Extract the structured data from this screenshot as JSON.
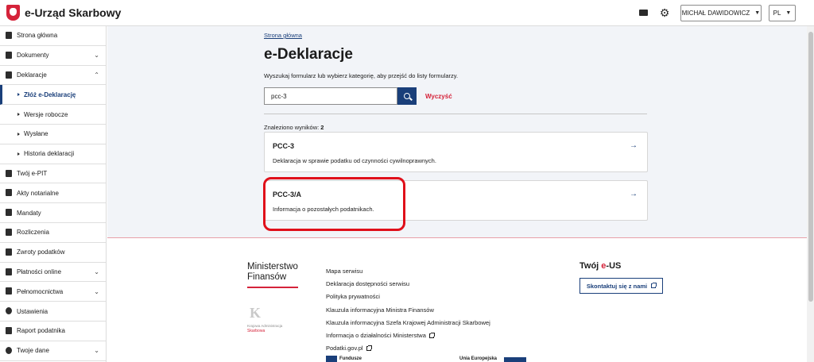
{
  "header": {
    "logo_text": "e-Urząd Skarbowy",
    "user_name": "MICHAŁ DAWIDOWICZ",
    "language": "PL",
    "mail_icon": "mail-icon",
    "settings_icon": "gear-icon"
  },
  "sidebar": {
    "items": [
      {
        "label": "Strona główna",
        "icon": "home-icon"
      },
      {
        "label": "Dokumenty",
        "icon": "document-icon"
      },
      {
        "label": "Deklaracje",
        "icon": "declaration-icon"
      },
      {
        "label": "Złóż e-Deklarację"
      },
      {
        "label": "Wersje robocze"
      },
      {
        "label": "Wysłane"
      },
      {
        "label": "Historia deklaracji"
      },
      {
        "label": "Twój e-PIT",
        "icon": "pit-icon"
      },
      {
        "label": "Akty notarialne",
        "icon": "notary-icon"
      },
      {
        "label": "Mandaty",
        "icon": "gavel-icon"
      },
      {
        "label": "Rozliczenia",
        "icon": "wallet-icon"
      },
      {
        "label": "Zwroty podatków",
        "icon": "refund-icon"
      },
      {
        "label": "Płatności online",
        "icon": "payment-icon"
      },
      {
        "label": "Pełnomocnictwa",
        "icon": "proxy-icon"
      },
      {
        "label": "Ustawienia",
        "icon": "gear-icon"
      },
      {
        "label": "Raport podatnika",
        "icon": "report-icon"
      },
      {
        "label": "Twoje dane",
        "icon": "user-icon"
      }
    ]
  },
  "main": {
    "breadcrumb": "Strona główna",
    "title": "e-Deklaracje",
    "intro": "Wyszukaj formularz lub wybierz kategorię, aby przejść do listy formularzy.",
    "search_value": "pcc-3",
    "clear_label": "Wyczyść",
    "results_label": "Znaleziono wyników:",
    "results_count": "2",
    "cards": [
      {
        "code": "PCC-3",
        "description": "Deklaracja w sprawie podatku od czynności cywilnoprawnych."
      },
      {
        "code": "PCC-3/A",
        "description": "Informacja o pozostałych podatnikach."
      }
    ]
  },
  "footer": {
    "ministry_line1": "Ministerstwo",
    "ministry_line2": "Finansów",
    "kas_sub": "Krajowa Administracja",
    "kas_skarbowa": "Skarbowa",
    "links": [
      "Mapa serwisu",
      "Deklaracja dostępności serwisu",
      "Polityka prywatności",
      "Klauzula informacyjna Ministra Finansów",
      "Klauzula informacyjna Szefa Krajowej Administracji Skarbowej",
      "Informacja o działalności Ministerstwa",
      "Podatki.gov.pl"
    ],
    "eus_title_prefix": "Twój ",
    "eus_title_red": "e",
    "eus_title_suffix": "-US",
    "contact_button": "Skontaktuj się z nami",
    "bottom_text1": "Fundusze",
    "bottom_text2": "Unia Europejska"
  },
  "colors": {
    "primary": "#1a3f7a",
    "accent_red": "#d5233a",
    "highlight": "#e0101a",
    "main_background": "#f2f4f8"
  }
}
